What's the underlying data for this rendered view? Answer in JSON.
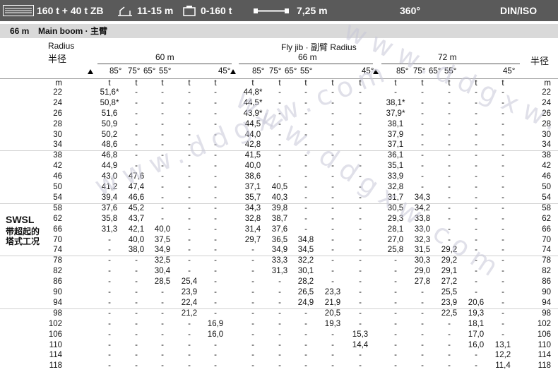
{
  "header": {
    "capacity": "160 t + 40 t ZB",
    "outrigger": "11-15 m",
    "counterweight": "0-160 t",
    "width": "7,25 m",
    "slew": "360°",
    "standard": "DIN/ISO"
  },
  "boom": {
    "label": "66 m",
    "title": "Main boom · 主臂"
  },
  "table_head": {
    "radius_en": "Radius",
    "radius_zh": "半径",
    "radius_zh_right": "半径",
    "fly_jib": "Fly jib · 副臂 Radius",
    "jib_lengths": [
      "60 m",
      "66 m",
      "72 m"
    ],
    "angles": [
      "85°",
      "75°",
      "65°",
      "55°",
      "45°"
    ],
    "unit_radius": "m",
    "unit_load": "t"
  },
  "side_label": {
    "code": "SWSL",
    "zh_line1": "带超起的",
    "zh_line2": "塔式工况"
  },
  "radii": [
    "22",
    "24",
    "26",
    "28",
    "30",
    "34",
    "38",
    "42",
    "46",
    "50",
    "54",
    "58",
    "62",
    "66",
    "70",
    "74",
    "78",
    "82",
    "86",
    "90",
    "94",
    "98",
    "102",
    "106",
    "110",
    "114",
    "118"
  ],
  "main_values": [
    "51,6*",
    "50,8*",
    "51,6",
    "50,9",
    "50,2",
    "48,6",
    "46,8",
    "44,9",
    "43,0",
    "41,2",
    "39,4",
    "37,6",
    "35,8",
    "31,3",
    "-",
    "-",
    "-",
    "-",
    "-",
    "-",
    "-",
    "-",
    "-",
    "-",
    "-",
    "-",
    "-"
  ],
  "jib_rows": [
    [
      [
        "-",
        "-",
        "-",
        "-"
      ],
      [
        "44,8*",
        "-",
        "-",
        "-",
        "-"
      ],
      [
        "-",
        "-",
        "-",
        "-",
        "-"
      ]
    ],
    [
      [
        "-",
        "-",
        "-",
        "-"
      ],
      [
        "44,5*",
        "-",
        "-",
        "-",
        "-"
      ],
      [
        "38,1*",
        "-",
        "-",
        "-",
        "-"
      ]
    ],
    [
      [
        "-",
        "-",
        "-",
        "-"
      ],
      [
        "43,9*",
        "-",
        "-",
        "-",
        "-"
      ],
      [
        "37,9*",
        "-",
        "-",
        "-",
        "-"
      ]
    ],
    [
      [
        "-",
        "-",
        "-",
        "-"
      ],
      [
        "44,5",
        "-",
        "-",
        "-",
        "-"
      ],
      [
        "38,1",
        "-",
        "-",
        "-",
        "-"
      ]
    ],
    [
      [
        "-",
        "-",
        "-",
        "-"
      ],
      [
        "44,0",
        "-",
        "-",
        "-",
        "-"
      ],
      [
        "37,9",
        "-",
        "-",
        "-",
        "-"
      ]
    ],
    [
      [
        "-",
        "-",
        "-",
        "-"
      ],
      [
        "42,8",
        "-",
        "-",
        "-",
        "-"
      ],
      [
        "37,1",
        "-",
        "-",
        "-",
        "-"
      ]
    ],
    [
      [
        "-",
        "-",
        "-",
        "-"
      ],
      [
        "41,5",
        "-",
        "-",
        "-",
        "-"
      ],
      [
        "36,1",
        "-",
        "-",
        "-",
        "-"
      ]
    ],
    [
      [
        "-",
        "-",
        "-",
        "-"
      ],
      [
        "40,0",
        "-",
        "-",
        "-",
        "-"
      ],
      [
        "35,1",
        "-",
        "-",
        "-",
        "-"
      ]
    ],
    [
      [
        "47,6",
        "-",
        "-",
        "-"
      ],
      [
        "38,6",
        "-",
        "-",
        "-",
        "-"
      ],
      [
        "33,9",
        "-",
        "-",
        "-",
        "-"
      ]
    ],
    [
      [
        "47,4",
        "-",
        "-",
        "-"
      ],
      [
        "37,1",
        "40,5",
        "-",
        "-",
        "-"
      ],
      [
        "32,8",
        "-",
        "-",
        "-",
        "-"
      ]
    ],
    [
      [
        "46,6",
        "-",
        "-",
        "-"
      ],
      [
        "35,7",
        "40,3",
        "-",
        "-",
        "-"
      ],
      [
        "31,7",
        "34,3",
        "-",
        "-",
        "-"
      ]
    ],
    [
      [
        "45,2",
        "-",
        "-",
        "-"
      ],
      [
        "34,3",
        "39,8",
        "-",
        "-",
        "-"
      ],
      [
        "30,5",
        "34,2",
        "-",
        "-",
        "-"
      ]
    ],
    [
      [
        "43,7",
        "-",
        "-",
        "-"
      ],
      [
        "32,8",
        "38,7",
        "-",
        "-",
        "-"
      ],
      [
        "29,3",
        "33,8",
        "-",
        "-",
        "-"
      ]
    ],
    [
      [
        "42,1",
        "40,0",
        "-",
        "-"
      ],
      [
        "31,4",
        "37,6",
        "-",
        "-",
        "-"
      ],
      [
        "28,1",
        "33,0",
        "-",
        "-",
        "-"
      ]
    ],
    [
      [
        "40,0",
        "37,5",
        "-",
        "-"
      ],
      [
        "29,7",
        "36,5",
        "34,8",
        "-",
        "-"
      ],
      [
        "27,0",
        "32,3",
        "-",
        "-",
        "-"
      ]
    ],
    [
      [
        "38,0",
        "34,9",
        "-",
        "-"
      ],
      [
        "-",
        "34,9",
        "34,5",
        "-",
        "-"
      ],
      [
        "25,8",
        "31,5",
        "29,2",
        "-",
        "-"
      ]
    ],
    [
      [
        "-",
        "32,5",
        "-",
        "-"
      ],
      [
        "-",
        "33,3",
        "32,2",
        "-",
        "-"
      ],
      [
        "-",
        "30,3",
        "29,2",
        "-",
        "-"
      ]
    ],
    [
      [
        "-",
        "30,4",
        "-",
        "-"
      ],
      [
        "-",
        "31,3",
        "30,1",
        "-",
        "-"
      ],
      [
        "-",
        "29,0",
        "29,1",
        "-",
        "-"
      ]
    ],
    [
      [
        "-",
        "28,5",
        "25,4",
        "-"
      ],
      [
        "-",
        "-",
        "28,2",
        "-",
        "-"
      ],
      [
        "-",
        "27,8",
        "27,2",
        "-",
        "-"
      ]
    ],
    [
      [
        "-",
        "-",
        "23,9",
        "-"
      ],
      [
        "-",
        "-",
        "26,5",
        "23,3",
        "-"
      ],
      [
        "-",
        "-",
        "25,5",
        "-",
        "-"
      ]
    ],
    [
      [
        "-",
        "-",
        "22,4",
        "-"
      ],
      [
        "-",
        "-",
        "24,9",
        "21,9",
        "-"
      ],
      [
        "-",
        "-",
        "23,9",
        "20,6",
        "-"
      ]
    ],
    [
      [
        "-",
        "-",
        "21,2",
        "-"
      ],
      [
        "-",
        "-",
        "-",
        "20,5",
        "-"
      ],
      [
        "-",
        "-",
        "22,5",
        "19,3",
        "-"
      ]
    ],
    [
      [
        "-",
        "-",
        "-",
        "16,9"
      ],
      [
        "-",
        "-",
        "-",
        "19,3",
        "-"
      ],
      [
        "-",
        "-",
        "-",
        "18,1",
        "-"
      ]
    ],
    [
      [
        "-",
        "-",
        "-",
        "16,0"
      ],
      [
        "-",
        "-",
        "-",
        "-",
        "15,3"
      ],
      [
        "-",
        "-",
        "-",
        "17,0",
        "-"
      ]
    ],
    [
      [
        "-",
        "-",
        "-",
        "-"
      ],
      [
        "-",
        "-",
        "-",
        "-",
        "14,4"
      ],
      [
        "-",
        "-",
        "-",
        "16,0",
        "13,1"
      ]
    ],
    [
      [
        "-",
        "-",
        "-",
        "-"
      ],
      [
        "-",
        "-",
        "-",
        "-",
        "-"
      ],
      [
        "-",
        "-",
        "-",
        "-",
        "12,2"
      ]
    ],
    [
      [
        "-",
        "-",
        "-",
        "-"
      ],
      [
        "-",
        "-",
        "-",
        "-",
        "-"
      ],
      [
        "-",
        "-",
        "-",
        "-",
        "11,4"
      ]
    ]
  ],
  "watermark": "www.ddgxw.com"
}
